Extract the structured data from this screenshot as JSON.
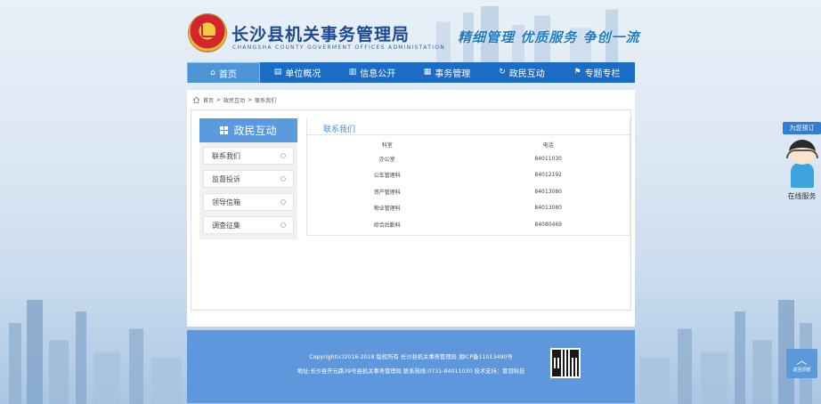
{
  "header": {
    "title": "长沙县机关事务管理局",
    "subtitle": "CHANGSHA COUNTY GOVERMENT OFFICES ADMINISTATION",
    "slogan": "精细管理 优质服务 争创一流"
  },
  "nav": {
    "items": [
      {
        "label": "首页",
        "icon": "home-icon",
        "active": true
      },
      {
        "label": "单位概况",
        "icon": "building-icon"
      },
      {
        "label": "信息公开",
        "icon": "book-icon"
      },
      {
        "label": "事务管理",
        "icon": "grid-icon"
      },
      {
        "label": "政民互动",
        "icon": "refresh-icon"
      },
      {
        "label": "专题专栏",
        "icon": "flag-icon"
      }
    ]
  },
  "breadcrumb": {
    "items": [
      "首页",
      "政民互动",
      "联系我们"
    ],
    "separator": ">"
  },
  "sidebar": {
    "title": "政民互动",
    "items": [
      {
        "label": "联系我们"
      },
      {
        "label": "监督投诉"
      },
      {
        "label": "领导信箱"
      },
      {
        "label": "调查征集"
      }
    ]
  },
  "main": {
    "title": "联系我们",
    "table": {
      "headers": [
        "科室",
        "电话"
      ],
      "rows": [
        [
          "办公室",
          "84011030"
        ],
        [
          "公车管理科",
          "84012192"
        ],
        [
          "资产管理科",
          "84013080"
        ],
        [
          "物业管理科",
          "84013080"
        ],
        [
          "综合后勤科",
          "84080469"
        ]
      ]
    }
  },
  "footer": {
    "copyright": "Copyright(c)2016-2018 版权所有 长沙县机关事务管理局 湘ICP备11013490号",
    "address": "地址:长沙县开元路39号县机关事务管理局 联系热线:0731-84011030 技术支持：管羽科技"
  },
  "online_service": {
    "tag": "为您预订",
    "label": "在线服务"
  },
  "back_to_top": {
    "label": "返回顶部"
  },
  "colors": {
    "nav_bg": "#1a6cc5",
    "accent": "#5a9be0",
    "footer_bg": "#5e97dc",
    "title": "#1d4a93"
  }
}
